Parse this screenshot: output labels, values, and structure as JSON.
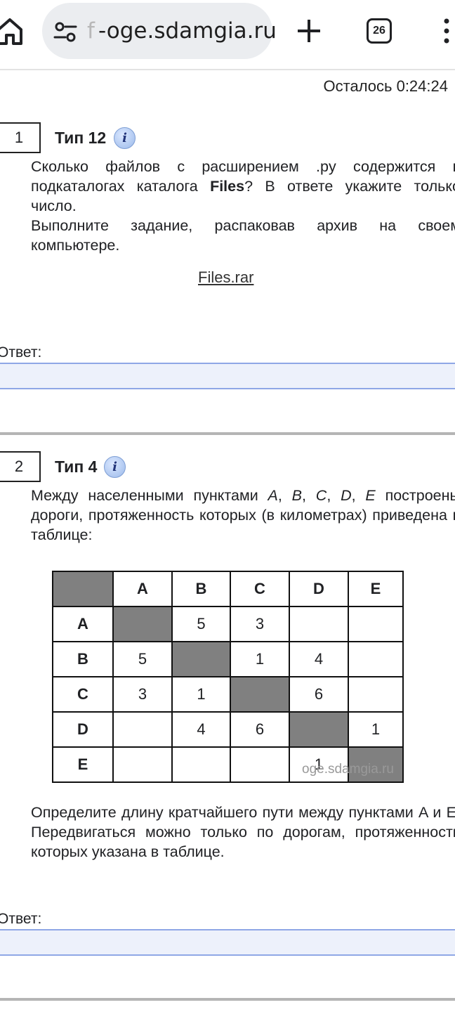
{
  "browser": {
    "url_prefix": "f",
    "url": "-oge.sdamgia.ru",
    "tab_count": "26"
  },
  "timer": "Осталось 0:24:24",
  "tasks": [
    {
      "number": "1",
      "type": "Тип 12",
      "info_icon": "i",
      "question_parts": {
        "a": "Сколько файлов с расширением .py содержится в подкаталогах каталога ",
        "bold": "Files",
        "b": "? В ответе укажите только число."
      },
      "instruction": "Выполните задание, распаковав архив на своем компьютере.",
      "attachment": "Files.rar",
      "answer_label": "Ответ:"
    },
    {
      "number": "2",
      "type": "Тип 4",
      "info_icon": "i",
      "question_parts": {
        "a": "Между населенными пунктами ",
        "points": [
          "A",
          "B",
          "C",
          "D",
          "E"
        ],
        "sep": ", ",
        "b": " построены дороги, протяженность которых (в километрах) приведена в таблице:"
      },
      "table": {
        "headers": [
          "A",
          "B",
          "C",
          "D",
          "E"
        ],
        "rows": [
          {
            "label": "A",
            "cells": [
              "",
              "5",
              "3",
              "",
              ""
            ]
          },
          {
            "label": "B",
            "cells": [
              "5",
              "",
              "1",
              "4",
              ""
            ]
          },
          {
            "label": "C",
            "cells": [
              "3",
              "1",
              "",
              "6",
              ""
            ]
          },
          {
            "label": "D",
            "cells": [
              "",
              "4",
              "6",
              "",
              "1"
            ]
          },
          {
            "label": "E",
            "cells": [
              "",
              "",
              "",
              "1",
              ""
            ]
          }
        ]
      },
      "watermark": "oge.sdamgia.ru",
      "followup": "Определите длину кратчайшего пути между пунктами A и E. Передвигаться можно только по дорогам, протяженность которых указана в таблице.",
      "answer_label": "Ответ:"
    }
  ]
}
